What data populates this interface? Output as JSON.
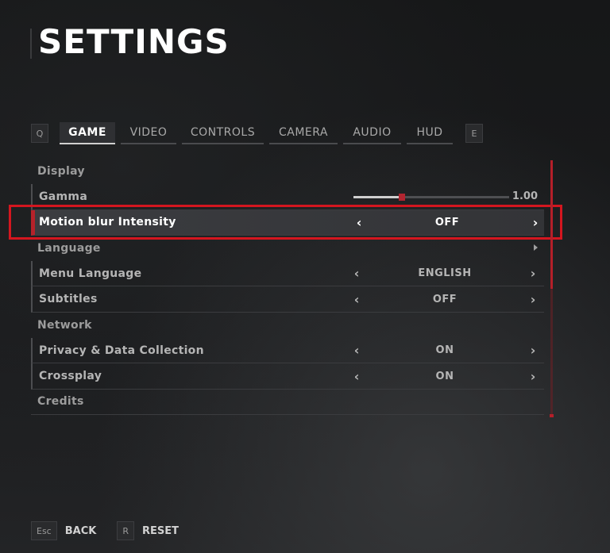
{
  "title": "SETTINGS",
  "tabs": {
    "prev_key": "Q",
    "next_key": "E",
    "items": [
      {
        "label": "GAME",
        "active": true
      },
      {
        "label": "VIDEO",
        "active": false
      },
      {
        "label": "CONTROLS",
        "active": false
      },
      {
        "label": "CAMERA",
        "active": false
      },
      {
        "label": "AUDIO",
        "active": false
      },
      {
        "label": "HUD",
        "active": false
      }
    ]
  },
  "settings": {
    "display_section": "Display",
    "gamma": {
      "label": "Gamma",
      "value": "1.00",
      "level": 0.31
    },
    "motion_blur": {
      "label": "Motion blur Intensity",
      "value": "OFF"
    },
    "language_section": "Language",
    "menu_language": {
      "label": "Menu Language",
      "value": "ENGLISH"
    },
    "subtitles": {
      "label": "Subtitles",
      "value": "OFF"
    },
    "network_section": "Network",
    "privacy": {
      "label": "Privacy & Data Collection",
      "value": "ON"
    },
    "crossplay": {
      "label": "Crossplay",
      "value": "ON"
    },
    "credits_section": "Credits"
  },
  "arrows": {
    "left": "‹",
    "right": "›"
  },
  "footer": {
    "back_key": "Esc",
    "back_label": "BACK",
    "reset_key": "R",
    "reset_label": "RESET"
  },
  "colors": {
    "accent": "#d4161f",
    "selected_bg": "#3b3c40"
  }
}
